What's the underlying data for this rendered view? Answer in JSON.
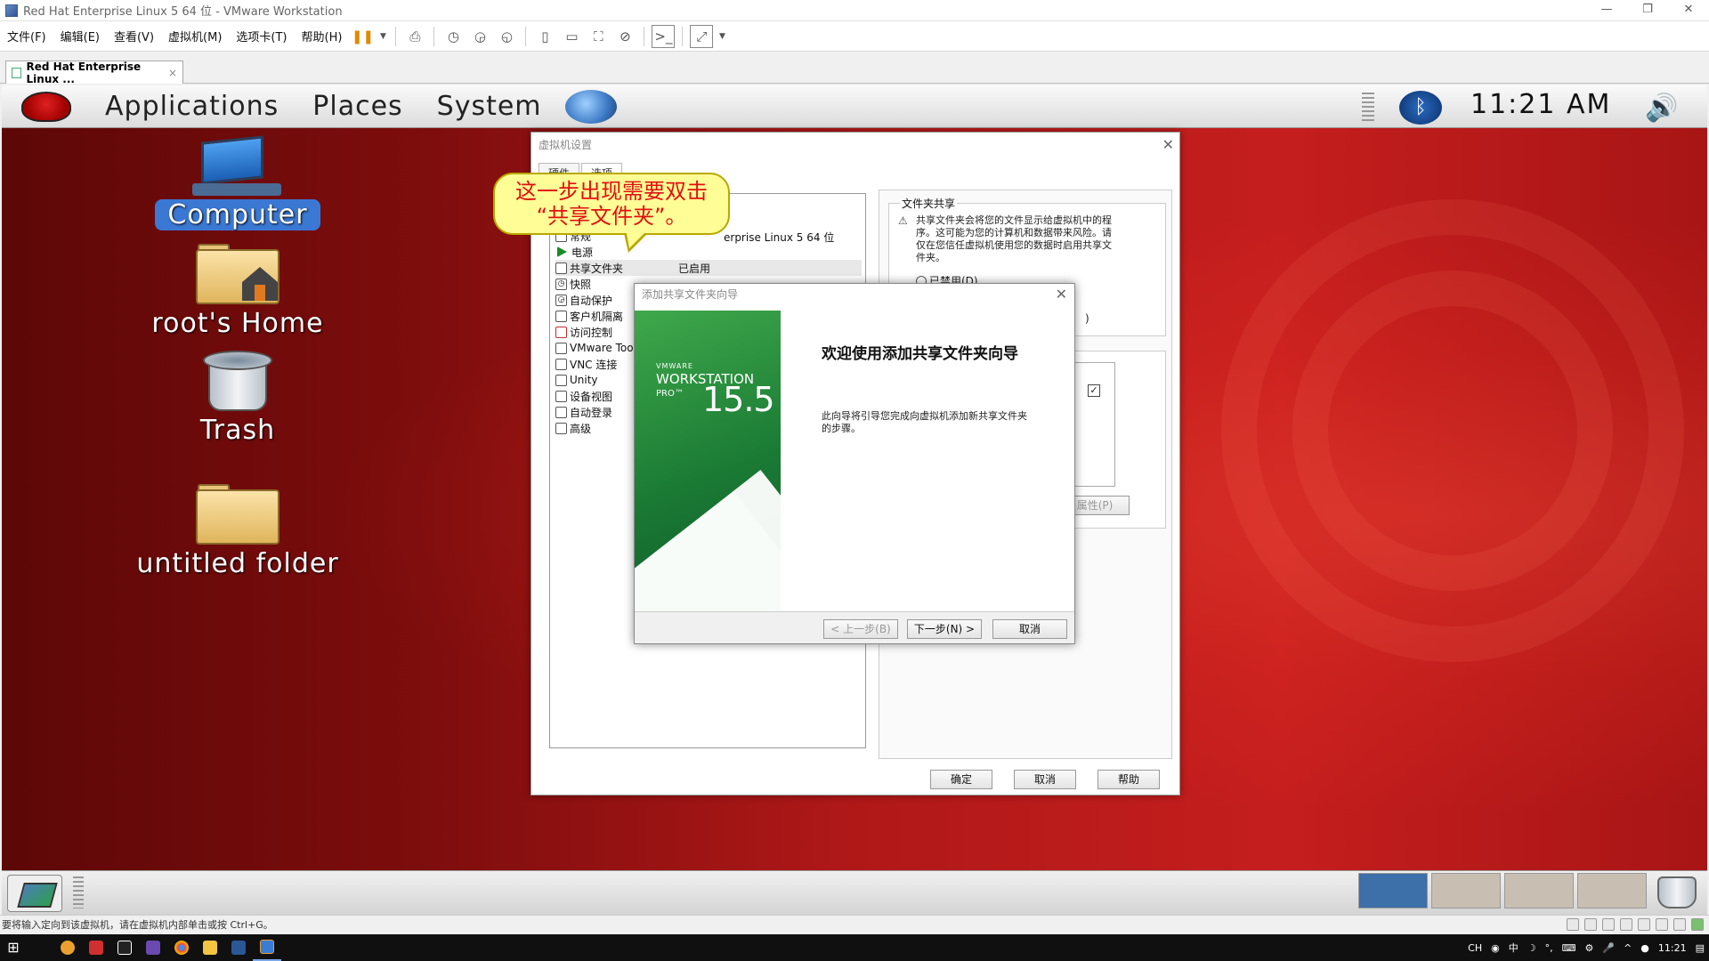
{
  "window": {
    "title": "Red Hat Enterprise Linux 5 64 位 - VMware Workstation",
    "controls": [
      "—",
      "❐",
      "✕"
    ]
  },
  "menubar": {
    "items": [
      "文件(F)",
      "编辑(E)",
      "查看(V)",
      "虚拟机(M)",
      "选项卡(T)",
      "帮助(H)"
    ]
  },
  "vm_tab": {
    "label": "Red Hat Enterprise Linux ...",
    "close": "×"
  },
  "gnome_panel": {
    "menus": [
      "Applications",
      "Places",
      "System"
    ],
    "clock": "11:21 AM",
    "bluetooth": "ᛒ",
    "volume": "🔊"
  },
  "desktop_icons": [
    {
      "label": "Computer",
      "selected": true
    },
    {
      "label": "root's Home"
    },
    {
      "label": "Trash"
    },
    {
      "label": "untitled folder"
    }
  ],
  "vm_settings": {
    "title": "虚拟机设置",
    "tabs": [
      "硬件",
      "选项"
    ],
    "list": [
      {
        "label": "常规",
        "value": "Red Hat Enterprise Linux 5 64 位"
      },
      {
        "label": "电源",
        "value": ""
      },
      {
        "label": "共享文件夹",
        "value": "已启用"
      },
      {
        "label": "快照",
        "value": ""
      },
      {
        "label": "自动保护",
        "value": ""
      },
      {
        "label": "客户机隔离",
        "value": ""
      },
      {
        "label": "访问控制",
        "value": ""
      },
      {
        "label": "VMware Tools",
        "value": ""
      },
      {
        "label": "VNC 连接",
        "value": ""
      },
      {
        "label": "Unity",
        "value": ""
      },
      {
        "label": "设备视图",
        "value": ""
      },
      {
        "label": "自动登录",
        "value": ""
      },
      {
        "label": "高级",
        "value": ""
      }
    ],
    "list_value_general_visible": "erprise Linux 5 64 位",
    "share_group_title": "文件夹共享",
    "share_warning": "共享文件夹会将您的文件显示给虚拟机中的程序。这可能为您的计算机和数据带来风险。请仅在您信任虚拟机使用您的数据时启用共享文件夹。",
    "radio_disabled": "已禁用(D)",
    "radio_partial": ")",
    "properties_button": "属性(P)",
    "ok_button": "确定",
    "cancel_button": "取消",
    "help_button": "帮助"
  },
  "wizard": {
    "title": "添加共享文件夹向导",
    "brand_vmware": "VMWARE",
    "brand_product": "WORKSTATION",
    "brand_edition": "PRO™",
    "brand_version": "15.5",
    "heading": "欢迎使用添加共享文件夹向导",
    "description": "此向导将引导您完成向虚拟机添加新共享文件夹的步骤。",
    "back_button": "< 上一步(B)",
    "next_button": "下一步(N) >",
    "cancel_button": "取消"
  },
  "callout": {
    "line1": "这一步出现需要双击",
    "line2": "“共享文件夹”。"
  },
  "statusbar": {
    "text": "要将输入定向到该虚拟机，请在虚拟机内部单击或按 Ctrl+G。"
  },
  "taskbar": {
    "tray": [
      "CH",
      "中",
      "11:21"
    ]
  },
  "colors": {
    "desktop_red": "#b01818",
    "selection_blue": "#3a78d4",
    "callout_yellow": "#fffd96",
    "callout_text": "#e01010",
    "vmware_green": "#1a7a34"
  }
}
